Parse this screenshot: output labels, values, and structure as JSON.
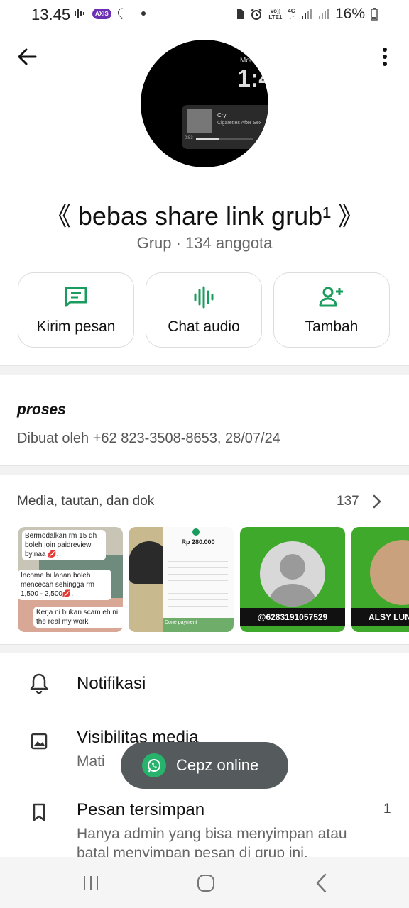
{
  "status_bar": {
    "time": "13.45",
    "carrier_badge": "AXIS",
    "network_volte": "Vo))",
    "network_lte": "LTE1",
    "network_4g": "4G",
    "battery": "16%"
  },
  "header": {
    "back_icon": "arrow-left-icon",
    "menu_icon": "more-vert-icon",
    "avatar_lockscreen_time": "1:4",
    "avatar_day": "Mon",
    "avatar_song": "Cry",
    "avatar_artist": "Cigarettes After Sex",
    "avatar_elapsed": "0:53"
  },
  "group": {
    "name": "《 bebas share link grub¹ 》",
    "subtitle": "Grup · 134 anggota"
  },
  "actions": [
    {
      "label": "Kirim pesan",
      "icon": "message-icon"
    },
    {
      "label": "Chat audio",
      "icon": "audio-wave-icon"
    },
    {
      "label": "Tambah",
      "icon": "add-person-icon"
    }
  ],
  "description": {
    "title": "proses",
    "created": "Dibuat oleh +62 823-3508-8653, 28/07/24"
  },
  "media": {
    "title": "Media, tautan, dan dok",
    "count": "137",
    "thumb1_lines": [
      "Bermodalkan rm 15 dh boleh join paidreview byinaa 💋.",
      "Income bulanan boleh mencecah sehingga rm 1,500 - 2,500💋.",
      "Kerja ni bukan scam eh ni the real my work"
    ],
    "thumb2_amount": "Rp 280.000",
    "thumb2_footer": "Done payment",
    "thumb3_label": "@6283191057529",
    "thumb4_label": "ALSY LUN"
  },
  "settings": [
    {
      "title": "Notifikasi",
      "icon": "bell-icon"
    },
    {
      "title": "Visibilitas media",
      "subtitle": "Mati",
      "icon": "image-icon"
    },
    {
      "title": "Pesan tersimpan",
      "subtitle": "Hanya admin yang bisa menyimpan atau batal menyimpan pesan di grup ini.",
      "badge": "1",
      "icon": "bookmark-icon"
    }
  ],
  "toast": {
    "text": "Cepz online",
    "icon": "whatsapp-icon"
  },
  "colors": {
    "accent_green": "#1a9c5e",
    "toast_bg": "#555a5d"
  }
}
